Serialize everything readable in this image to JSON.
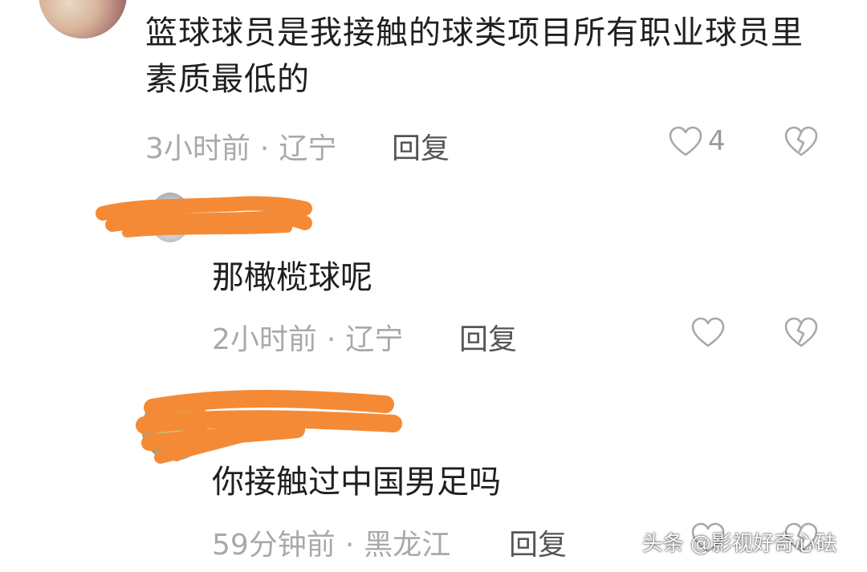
{
  "comments": [
    {
      "text": "篮球球员是我接触的球类项目所有职业球员里素质最低的",
      "time": "3小时前",
      "location": "辽宁",
      "reply_label": "回复",
      "likes": "4"
    },
    {
      "text": "那橄榄球呢",
      "time": "2小时前",
      "location": "辽宁",
      "reply_label": "回复"
    },
    {
      "text": "你接触过中国男足吗",
      "time": "59分钟前",
      "location": "黑龙江",
      "reply_label": "回复"
    }
  ],
  "icons": {
    "like": "heart-outline-icon",
    "dislike": "broken-heart-icon"
  },
  "watermark": "头条 @影视好奇心砝",
  "colors": {
    "text": "#1f1f1f",
    "meta": "#a9a9ad",
    "redaction": "#f58a36"
  }
}
